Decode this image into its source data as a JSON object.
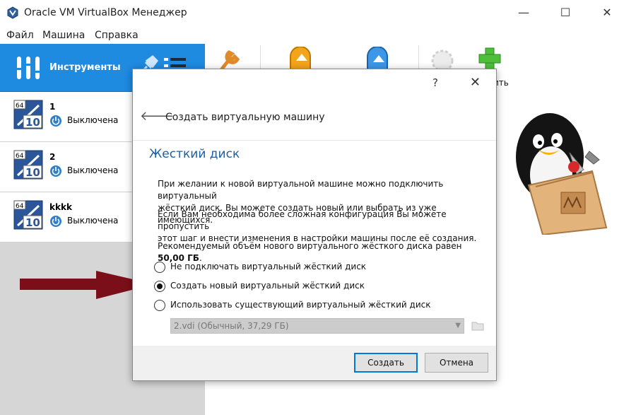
{
  "window": {
    "title": "Oracle VM VirtualBox Менеджер",
    "minimize_glyph": "—",
    "maximize_glyph": "☐",
    "close_glyph": "✕"
  },
  "menu": [
    "Файл",
    "Машина",
    "Справка"
  ],
  "sidebar": {
    "tools_label": "Инструменты",
    "vms": [
      {
        "name": "1",
        "state": "Выключена",
        "badge": "64",
        "os": "10"
      },
      {
        "name": "2",
        "state": "Выключена",
        "badge": "64",
        "os": "10"
      },
      {
        "name": "kkkk",
        "state": "Выключена",
        "badge": "64",
        "os": "10"
      }
    ]
  },
  "toolbar": {
    "partial_label": "ить",
    "icons": [
      "settings-icon",
      "discard-icon",
      "start-icon",
      "import-icon",
      "new-vm-icon"
    ]
  },
  "dialog": {
    "help_glyph": "?",
    "close_glyph": "✕",
    "back_glyph": "🡐",
    "title": "Создать виртуальную машину",
    "heading": "Жесткий диск",
    "para1_line1": "При желании к новой виртуальной машине можно подключить виртуальный",
    "para1_line2": "жёсткий диск. Вы можете создать новый или выбрать из уже имеющихся.",
    "para2_line1": "Если Вам необходима более сложная конфигурация Вы можете пропустить",
    "para2_line2": "этот шаг и внести изменения в настройки машины после её создания.",
    "para3_prefix": "Рекомендуемый объём нового виртуального жёсткого диска равен ",
    "para3_value": "50,00 ГБ",
    "para3_suffix": ".",
    "options": [
      {
        "label": "Не подключать виртуальный жёсткий диск",
        "checked": false
      },
      {
        "label": "Создать новый виртуальный жёсткий диск",
        "checked": true
      },
      {
        "label": "Использовать существующий виртуальный жёсткий диск",
        "checked": false
      }
    ],
    "existing_disk_value": "2.vdi (Обычный, 37,29 ГБ)",
    "create_button": "Создать",
    "cancel_button": "Отмена"
  },
  "colors": {
    "accent": "#1e8ae0",
    "heading": "#1a5fa6",
    "annotation_arrow": "#7a0f1a"
  }
}
